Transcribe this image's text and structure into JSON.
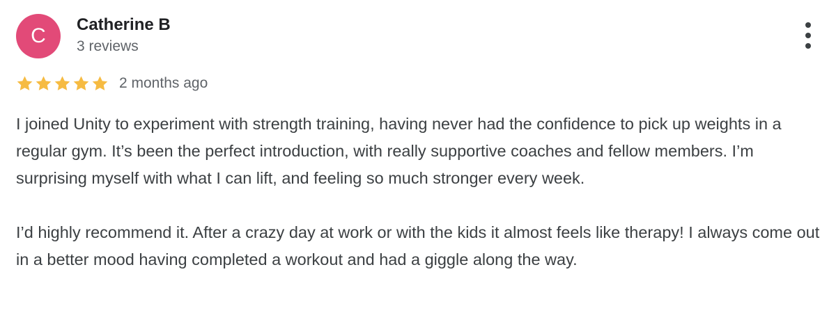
{
  "reviewer": {
    "initial": "C",
    "name": "Catherine B",
    "meta": "3 reviews",
    "avatar_color": "#e24a78"
  },
  "review": {
    "rating": 5,
    "rating_max": 5,
    "star_color": "#f6bb42",
    "timestamp": "2 months ago",
    "paragraphs": [
      "I joined Unity to experiment with strength training, having never had the confidence to pick up weights in a regular gym. It’s been the perfect introduction, with really supportive coaches and fellow members. I’m surprising myself with what I can lift, and feeling so much stronger every week.",
      "I’d highly recommend it. After a crazy day at work or with the kids it almost feels like therapy! I always come out in a better mood having completed a workout and had a giggle along the way."
    ]
  },
  "actions": {
    "more_icon": "more-vertical-icon"
  }
}
